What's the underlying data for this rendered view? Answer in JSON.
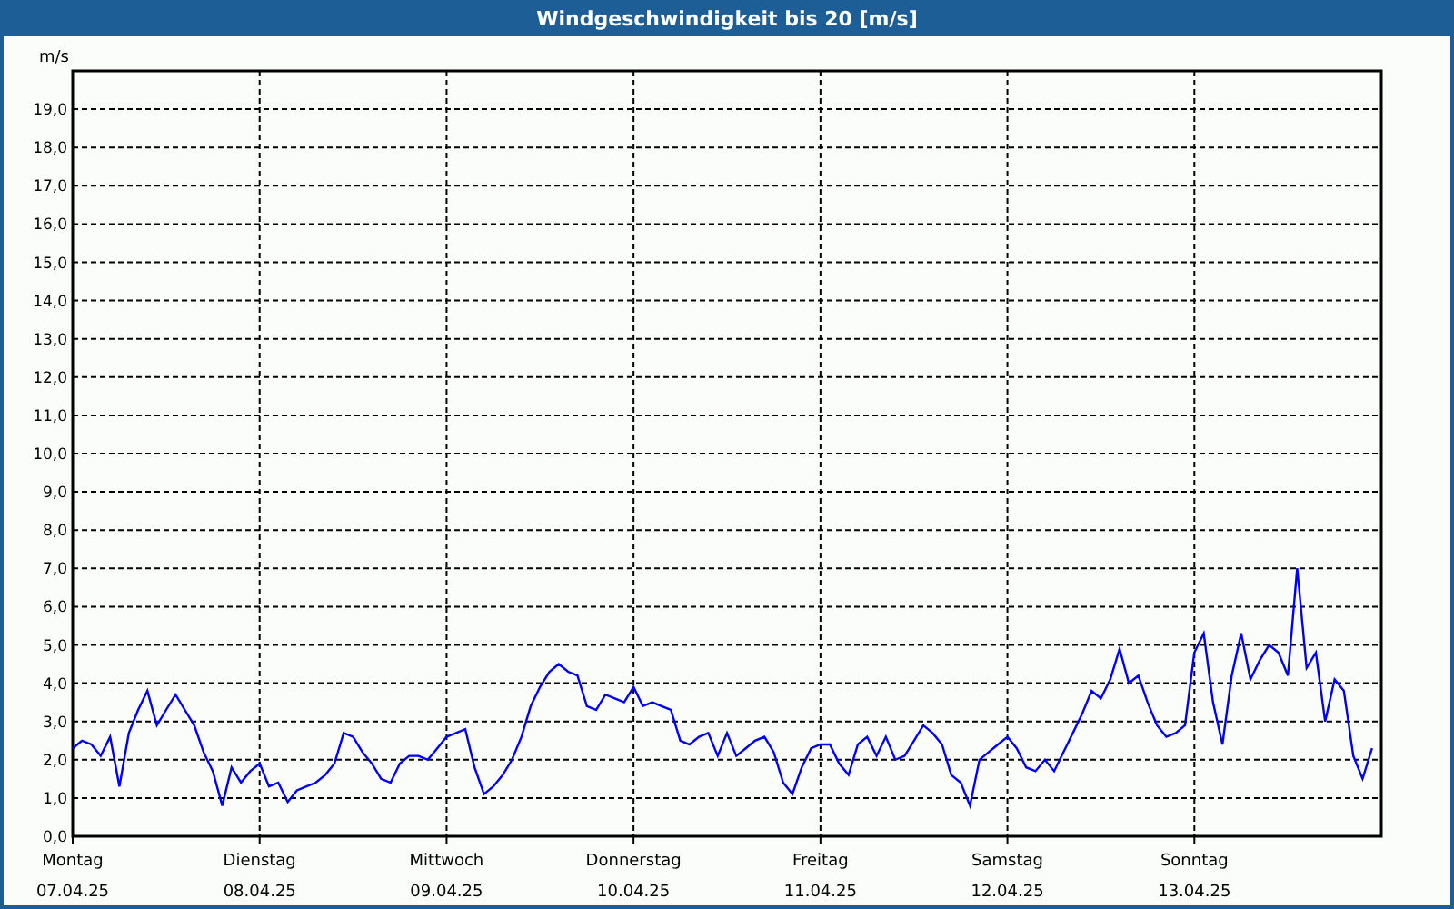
{
  "chart_data": {
    "type": "line",
    "title": "Windgeschwindigkeit bis 20 [m/s]",
    "ylabel": "m/s",
    "ylim": [
      0,
      20
    ],
    "grid": true,
    "categories": [
      "Montag\n07.04.25",
      null,
      null,
      null,
      null,
      null,
      null,
      null,
      null,
      null,
      null,
      null,
      null,
      null,
      null,
      null,
      null,
      null,
      null,
      null,
      "Dienstag\n08.04.25",
      null,
      null,
      null,
      null,
      null,
      null,
      null,
      null,
      null,
      null,
      null,
      null,
      null,
      null,
      null,
      null,
      null,
      null,
      null,
      "Mittwoch\n09.04.25",
      null,
      null,
      null,
      null,
      null,
      null,
      null,
      null,
      null,
      null,
      null,
      null,
      null,
      null,
      null,
      null,
      null,
      null,
      null,
      "Donnerstag\n10.04.25",
      null,
      null,
      null,
      null,
      null,
      null,
      null,
      null,
      null,
      null,
      null,
      null,
      null,
      null,
      null,
      null,
      null,
      null,
      null,
      "Freitag\n11.04.25",
      null,
      null,
      null,
      null,
      null,
      null,
      null,
      null,
      null,
      null,
      null,
      null,
      null,
      null,
      null,
      null,
      null,
      null,
      null,
      "Samstag\n12.04.25",
      null,
      null,
      null,
      null,
      null,
      null,
      null,
      null,
      null,
      null,
      null,
      null,
      null,
      null,
      null,
      null,
      null,
      null,
      null,
      "Sonntag\n13.04.25",
      null,
      null,
      null,
      null,
      null,
      null,
      null,
      null,
      null,
      null,
      null,
      null,
      null,
      null,
      null,
      null,
      null,
      null,
      null
    ],
    "series": [
      {
        "color": "#0000ff",
        "values": [
          2.3,
          2.5,
          2.4,
          2.1,
          2.6,
          1.3,
          2.7,
          3.3,
          3.8,
          2.9,
          3.3,
          3.7,
          3.3,
          2.9,
          2.2,
          1.7,
          0.8,
          1.8,
          1.4,
          1.7,
          1.9,
          1.3,
          1.4,
          0.9,
          1.2,
          1.3,
          1.4,
          1.6,
          1.9,
          2.7,
          2.6,
          2.2,
          1.9,
          1.5,
          1.4,
          1.9,
          2.1,
          2.1,
          2.0,
          2.3,
          2.6,
          2.7,
          2.8,
          1.8,
          1.1,
          1.3,
          1.6,
          2.0,
          2.6,
          3.4,
          3.9,
          4.3,
          4.5,
          4.3,
          4.2,
          3.4,
          3.3,
          3.7,
          3.6,
          3.5,
          3.9,
          3.4,
          3.5,
          3.4,
          3.3,
          2.5,
          2.4,
          2.6,
          2.7,
          2.1,
          2.7,
          2.1,
          2.3,
          2.5,
          2.6,
          2.2,
          1.4,
          1.1,
          1.8,
          2.3,
          2.4,
          2.4,
          1.9,
          1.6,
          2.4,
          2.6,
          2.1,
          2.6,
          2.0,
          2.1,
          2.5,
          2.9,
          2.7,
          2.4,
          1.6,
          1.4,
          0.8,
          2.0,
          2.2,
          2.4,
          2.6,
          2.3,
          1.8,
          1.7,
          2.0,
          1.7,
          2.2,
          2.7,
          3.2,
          3.8,
          3.6,
          4.1,
          4.9,
          4.0,
          4.2,
          3.5,
          2.9,
          2.6,
          2.7,
          2.9,
          4.8,
          5.3,
          3.5,
          2.4,
          4.2,
          5.3,
          4.1,
          4.6,
          5.0,
          4.8,
          4.2,
          7.0,
          4.4,
          4.8,
          3.0,
          4.1,
          3.8,
          2.1,
          1.5,
          2.3
        ]
      }
    ],
    "yticks": [
      {
        "value": 0,
        "label": "0,0"
      },
      {
        "value": 1,
        "label": "1,0"
      },
      {
        "value": 2,
        "label": "2,0"
      },
      {
        "value": 3,
        "label": "3,0"
      },
      {
        "value": 4,
        "label": "4,0"
      },
      {
        "value": 5,
        "label": "5,0"
      },
      {
        "value": 6,
        "label": "6,0"
      },
      {
        "value": 7,
        "label": "7,0"
      },
      {
        "value": 8,
        "label": "8,0"
      },
      {
        "value": 9,
        "label": "9,0"
      },
      {
        "value": 10,
        "label": "10,0"
      },
      {
        "value": 11,
        "label": "11,0"
      },
      {
        "value": 12,
        "label": "12,0"
      },
      {
        "value": 13,
        "label": "13,0"
      },
      {
        "value": 14,
        "label": "14,0"
      },
      {
        "value": 15,
        "label": "15,0"
      },
      {
        "value": 16,
        "label": "16,0"
      },
      {
        "value": 17,
        "label": "17,0"
      },
      {
        "value": 18,
        "label": "18,0"
      },
      {
        "value": 19,
        "label": "19,0"
      }
    ]
  }
}
